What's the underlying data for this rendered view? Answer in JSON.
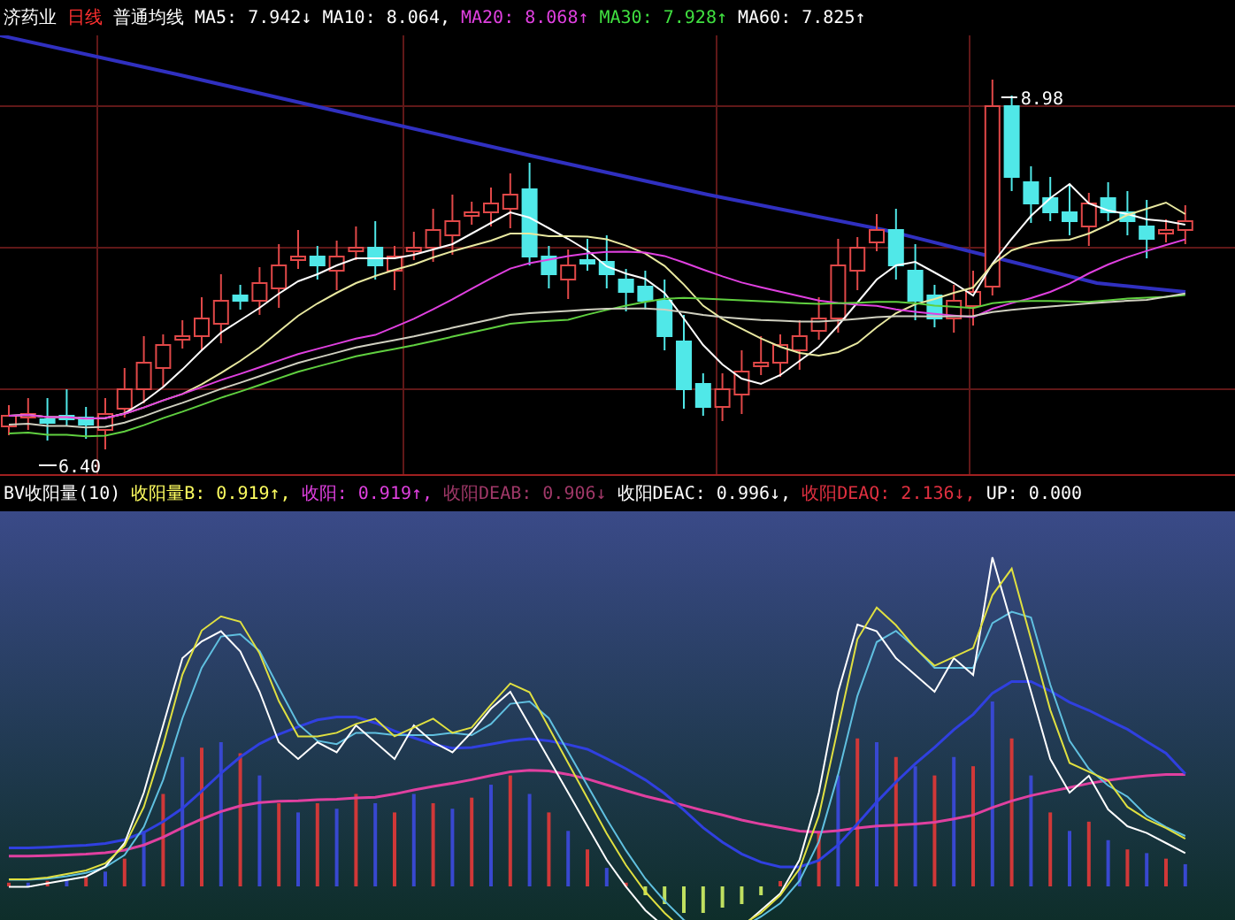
{
  "stock_header": {
    "title": "济药业",
    "period": "日线",
    "indicator": "普通均线",
    "values": [
      {
        "text": "MA5: 7.942↓",
        "color": "#ffffff"
      },
      {
        "text": "MA10: 8.064,",
        "color": "#ffffff"
      },
      {
        "text": "MA20: 8.068↑",
        "color": "#e040e0"
      },
      {
        "text": "MA30: 7.928↑",
        "color": "#40e040"
      },
      {
        "text": "MA60: 7.825↑",
        "color": "#ffffff"
      }
    ]
  },
  "price_chart": {
    "high_label": "8.98",
    "low_label": "6.40"
  },
  "indicator_panel": {
    "values": [
      {
        "text": "BV收阳量(10)",
        "color": "#ffffff"
      },
      {
        "text": "收阳量B: 0.919↑,",
        "color": "#ffff60"
      },
      {
        "text": "收阳: 0.919↑,",
        "color": "#e040e0"
      },
      {
        "text": "收阳DEAB: 0.906↓",
        "color": "#a03868"
      },
      {
        "text": "收阳DEAC: 0.996↓,",
        "color": "#ffffff"
      },
      {
        "text": "收阳DEAQ: 2.136↓,",
        "color": "#e03040"
      },
      {
        "text": "UP: 0.000",
        "color": "#ffffff"
      }
    ]
  }
}
